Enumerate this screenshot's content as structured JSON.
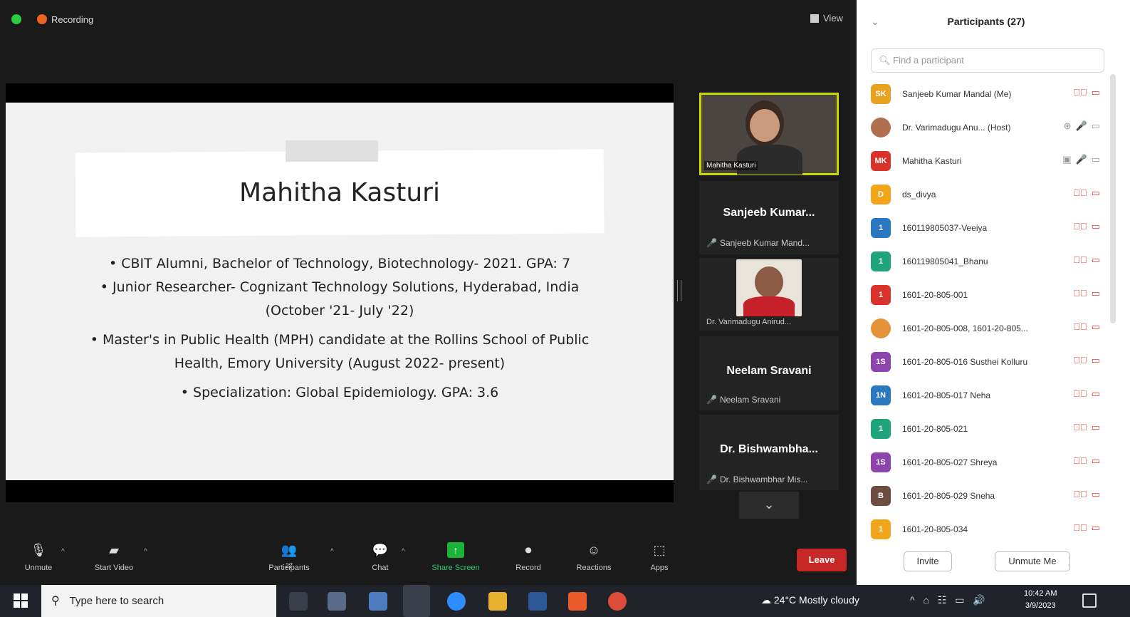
{
  "topbar": {
    "recording_label": "Recording",
    "view_label": "View"
  },
  "slide": {
    "name": "Mahitha Kasturi",
    "bullets": [
      {
        "lines": [
          "CBIT Alumni, Bachelor of Technology, Biotechnology- 2021. GPA: 7"
        ]
      },
      {
        "lines": [
          "Junior Researcher- Cognizant Technology Solutions, Hyderabad, India",
          "(October '21- July '22)"
        ]
      },
      {
        "lines": [
          "Master's in Public Health (MPH) candidate at the Rollins School of Public",
          "Health, Emory University (August 2022- present)"
        ]
      },
      {
        "lines": [
          "Specialization: Global Epidemiology. GPA: 3.6"
        ]
      }
    ]
  },
  "tiles": [
    {
      "type": "video",
      "name": "Mahitha Kasturi"
    },
    {
      "type": "name",
      "display": "Sanjeeb Kumar...",
      "sub": "Sanjeeb Kumar Mand..."
    },
    {
      "type": "video",
      "name": "Dr. Varimadugu Anirud..."
    },
    {
      "type": "name",
      "display": "Neelam Sravani",
      "sub": "Neelam Sravani"
    },
    {
      "type": "name",
      "display": "Dr. Bishwambha...",
      "sub": "Dr. Bishwambhar Mis..."
    }
  ],
  "toolbar": {
    "unmute": "Unmute",
    "start_video": "Start Video",
    "participants": "Participants",
    "participant_count": "27",
    "chat": "Chat",
    "share_screen": "Share Screen",
    "record": "Record",
    "reactions": "Reactions",
    "apps": "Apps",
    "leave": "Leave"
  },
  "panel": {
    "title": "Participants (27)",
    "search_placeholder": "Find a participant",
    "invite": "Invite",
    "unmute_me": "Unmute Me",
    "participants": [
      {
        "initials": "SK",
        "color": "#e8a21f",
        "name": "Sanjeeb Kumar Mandal (Me)",
        "icons": "muted"
      },
      {
        "initials": "",
        "color": "#b07050",
        "name": "Dr. Varimadugu Anu...  (Host)",
        "icons": "host",
        "photo": true
      },
      {
        "initials": "MK",
        "color": "#d9322a",
        "name": "Mahitha Kasturi",
        "icons": "active"
      },
      {
        "initials": "D",
        "color": "#f2a51a",
        "name": "ds_divya",
        "icons": "muted"
      },
      {
        "initials": "1",
        "color": "#2b78c2",
        "name": "160119805037-Veeiya",
        "icons": "muted"
      },
      {
        "initials": "1",
        "color": "#1fa37a",
        "name": "160119805041_Bhanu",
        "icons": "muted"
      },
      {
        "initials": "1",
        "color": "#d9322a",
        "name": "1601-20-805-001",
        "icons": "muted"
      },
      {
        "initials": "",
        "color": "#e5933a",
        "name": "1601-20-805-008, 1601-20-805...",
        "icons": "muted",
        "photo": true
      },
      {
        "initials": "1S",
        "color": "#8e44ad",
        "name": "1601-20-805-016 Susthei Kolluru",
        "icons": "muted"
      },
      {
        "initials": "1N",
        "color": "#2b78c2",
        "name": "1601-20-805-017 Neha",
        "icons": "muted"
      },
      {
        "initials": "1",
        "color": "#1fa37a",
        "name": "1601-20-805-021",
        "icons": "muted"
      },
      {
        "initials": "1S",
        "color": "#8e44ad",
        "name": "1601-20-805-027 Shreya",
        "icons": "muted"
      },
      {
        "initials": "B",
        "color": "#6d4c41",
        "name": "1601-20-805-029 Sneha",
        "icons": "muted"
      },
      {
        "initials": "1",
        "color": "#f2a51a",
        "name": "1601-20-805-034",
        "icons": "muted"
      }
    ]
  },
  "taskbar": {
    "search_placeholder": "Type here to search",
    "weather": "24°C  Mostly cloudy",
    "time": "10:42 AM",
    "date": "3/9/2023"
  }
}
